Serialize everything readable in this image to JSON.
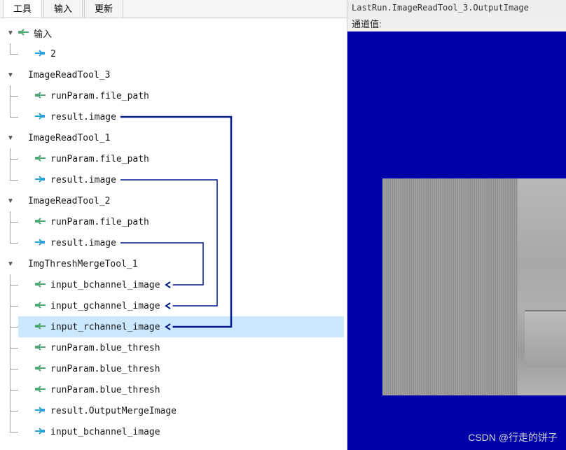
{
  "tabs": {
    "t0": "工具",
    "t1": "输入",
    "t2": "更新"
  },
  "right": {
    "title": "LastRun.ImageReadTool_3.OutputImage",
    "channel_label": "通道值:"
  },
  "watermark": "CSDN @行走的饼子",
  "tree": {
    "n0": {
      "label": "输入"
    },
    "n0_0": {
      "label": "2"
    },
    "n1": {
      "label": "ImageReadTool_3"
    },
    "n1_0": {
      "label": "runParam.file_path"
    },
    "n1_1": {
      "label": "result.image"
    },
    "n2": {
      "label": "ImageReadTool_1"
    },
    "n2_0": {
      "label": "runParam.file_path"
    },
    "n2_1": {
      "label": "result.image"
    },
    "n3": {
      "label": "ImageReadTool_2"
    },
    "n3_0": {
      "label": "runParam.file_path"
    },
    "n3_1": {
      "label": "result.image"
    },
    "n4": {
      "label": "ImgThreshMergeTool_1"
    },
    "n4_0": {
      "label": "input_bchannel_image"
    },
    "n4_1": {
      "label": "input_gchannel_image"
    },
    "n4_2": {
      "label": "input_rchannel_image"
    },
    "n4_3": {
      "label": "runParam.blue_thresh"
    },
    "n4_4": {
      "label": "runParam.blue_thresh"
    },
    "n4_5": {
      "label": "runParam.blue_thresh"
    },
    "n4_6": {
      "label": "result.OutputMergeImage"
    },
    "n4_7": {
      "label": "input_bchannel_image"
    }
  },
  "colors": {
    "arrow_in": "#4fa774",
    "arrow_out": "#2aa0d8",
    "wire": "#001a8c",
    "selected_bg": "#cce8ff"
  },
  "wires": [
    {
      "from": "n1_1",
      "to": "n4_2"
    },
    {
      "from": "n2_1",
      "to": "n4_1"
    },
    {
      "from": "n3_1",
      "to": "n4_0"
    }
  ]
}
